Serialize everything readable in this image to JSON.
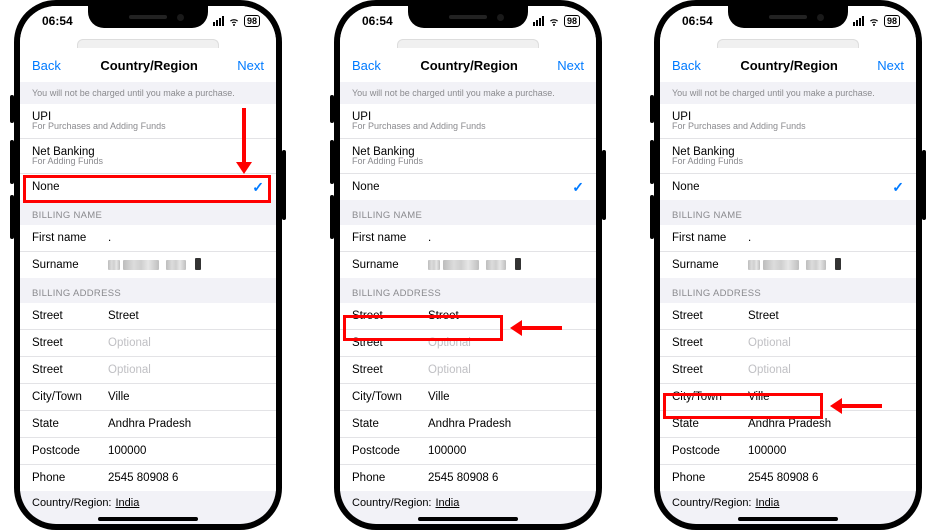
{
  "phones": [
    0,
    1,
    2
  ],
  "statusbar": {
    "time": "06:54",
    "battery": "98"
  },
  "nav": {
    "back": "Back",
    "title": "Country/Region",
    "next": "Next"
  },
  "notice": "You will not be charged until you make a purchase.",
  "payment": {
    "upi": {
      "title": "UPI",
      "sub": "For Purchases and Adding Funds"
    },
    "netbanking": {
      "title": "Net Banking",
      "sub": "For Adding Funds"
    },
    "none": "None"
  },
  "sections": {
    "billing_name": "BILLING NAME",
    "billing_address": "BILLING ADDRESS"
  },
  "labels": {
    "first_name": "First name",
    "surname": "Surname",
    "street": "Street",
    "city": "City/Town",
    "state": "State",
    "postcode": "Postcode",
    "phone": "Phone",
    "country": "Country/Region:"
  },
  "values": {
    "first_name": ".",
    "street1": "Street",
    "street_opt": "Optional",
    "city": "Ville",
    "state": "Andhra Pradesh",
    "postcode": "100000",
    "phone": "2545 80908 6",
    "country": "India"
  },
  "annotations": {
    "p0": {
      "highlight": "none-row",
      "arrow_down": true
    },
    "p1": {
      "highlight": "street-row",
      "arrow_left": true
    },
    "p2": {
      "highlight": "city-row",
      "arrow_left": true
    }
  }
}
